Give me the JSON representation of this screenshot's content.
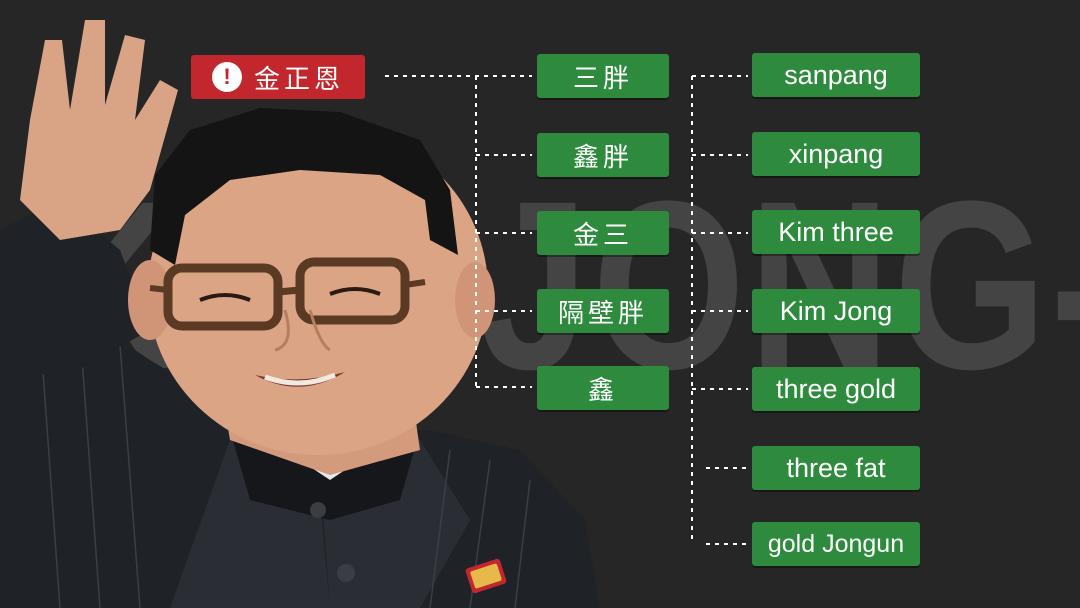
{
  "background_text": "KIM-JONG-UN",
  "root": {
    "label": "金正恩",
    "icon": "exclamation-icon",
    "icon_glyph": "!"
  },
  "nicknames": [
    "三胖",
    "鑫胖",
    "金三",
    "隔壁胖",
    "鑫"
  ],
  "translations": [
    "sanpang",
    "xinpang",
    "Kim three",
    "Kim Jong",
    "three gold",
    "three fat",
    "gold Jongun"
  ],
  "colors": {
    "background": "#262626",
    "green_tag": "#2e8b3e",
    "red_tag": "#c1272d",
    "ghost_text": "#444444",
    "connector": "#ffffff"
  }
}
